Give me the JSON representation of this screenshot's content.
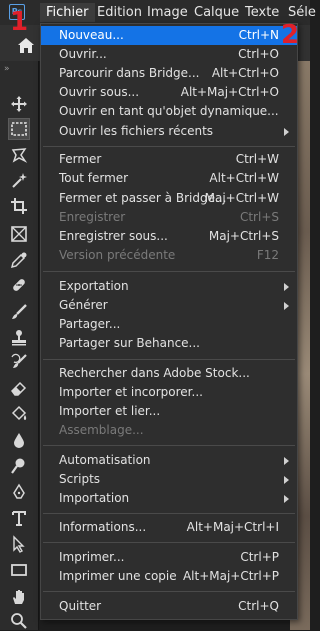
{
  "menubar": {
    "logo": "Ps",
    "items": [
      "Fichier",
      "Edition",
      "Image",
      "Calque",
      "Texte",
      "Séle"
    ]
  },
  "annotations": {
    "badge1": "1",
    "badge2": "2"
  },
  "colors": {
    "highlight": "#1473e6",
    "badge": "#e0202a",
    "menu_bg": "#2e2e2e"
  },
  "tools": [
    "move-icon",
    "marquee-icon",
    "lasso-icon",
    "magic-wand-icon",
    "crop-icon",
    "frame-icon",
    "eyedropper-icon",
    "healing-brush-icon",
    "brush-icon",
    "clone-stamp-icon",
    "history-brush-icon",
    "eraser-icon",
    "paint-bucket-icon",
    "blur-icon",
    "dodge-icon",
    "pen-icon",
    "type-icon",
    "path-selection-icon",
    "rectangle-icon",
    "hand-icon",
    "zoom-icon"
  ],
  "menu": {
    "items": [
      {
        "label": "Nouveau...",
        "shortcut": "Ctrl+N"
      },
      {
        "label": "Ouvrir...",
        "shortcut": "Ctrl+O"
      },
      {
        "label": "Parcourir dans Bridge...",
        "shortcut": "Alt+Ctrl+O"
      },
      {
        "label": "Ouvrir sous...",
        "shortcut": "Alt+Maj+Ctrl+O"
      },
      {
        "label": "Ouvrir en tant qu'objet dynamique...",
        "shortcut": ""
      },
      {
        "label": "Ouvrir les fichiers récents",
        "shortcut": ""
      },
      {
        "label": "Fermer",
        "shortcut": "Ctrl+W"
      },
      {
        "label": "Tout fermer",
        "shortcut": "Alt+Ctrl+W"
      },
      {
        "label": "Fermer et passer à Bridge...",
        "shortcut": "Maj+Ctrl+W"
      },
      {
        "label": "Enregistrer",
        "shortcut": "Ctrl+S"
      },
      {
        "label": "Enregistrer sous...",
        "shortcut": "Maj+Ctrl+S"
      },
      {
        "label": "Version précédente",
        "shortcut": "F12"
      },
      {
        "label": "Exportation",
        "shortcut": ""
      },
      {
        "label": "Générer",
        "shortcut": ""
      },
      {
        "label": "Partager...",
        "shortcut": ""
      },
      {
        "label": "Partager sur Behance...",
        "shortcut": ""
      },
      {
        "label": "Rechercher dans Adobe Stock...",
        "shortcut": ""
      },
      {
        "label": "Importer et incorporer...",
        "shortcut": ""
      },
      {
        "label": "Importer et lier...",
        "shortcut": ""
      },
      {
        "label": "Assemblage...",
        "shortcut": ""
      },
      {
        "label": "Automatisation",
        "shortcut": ""
      },
      {
        "label": "Scripts",
        "shortcut": ""
      },
      {
        "label": "Importation",
        "shortcut": ""
      },
      {
        "label": "Informations...",
        "shortcut": "Alt+Maj+Ctrl+I"
      },
      {
        "label": "Imprimer...",
        "shortcut": "Ctrl+P"
      },
      {
        "label": "Imprimer une copie",
        "shortcut": "Alt+Maj+Ctrl+P"
      },
      {
        "label": "Quitter",
        "shortcut": "Ctrl+Q"
      }
    ]
  }
}
